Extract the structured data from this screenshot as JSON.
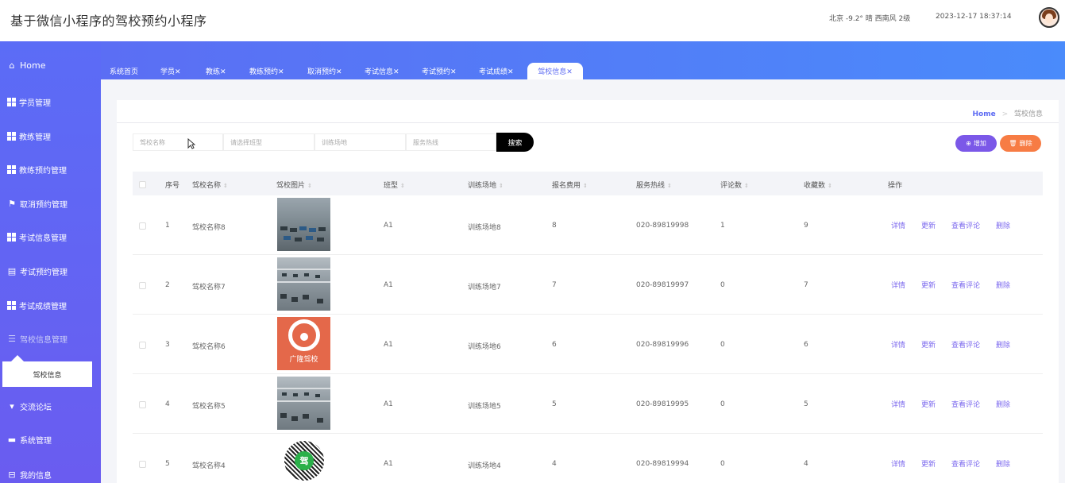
{
  "header": {
    "app_title": "基于微信小程序的驾校预约小程序",
    "weather": "北京  -9.2°  晴  西南风  2级",
    "datetime": "2023-12-17 18:37:14"
  },
  "sidebar": {
    "home": "Home",
    "items": [
      {
        "label": "学员管理"
      },
      {
        "label": "教练管理"
      },
      {
        "label": "教练预约管理"
      },
      {
        "label": "取消预约管理"
      },
      {
        "label": "考试信息管理"
      },
      {
        "label": "考试预约管理"
      },
      {
        "label": "考试成绩管理"
      },
      {
        "label": "驾校信息管理"
      },
      {
        "label": "交流论坛"
      },
      {
        "label": "系统管理"
      },
      {
        "label": "我的信息"
      }
    ],
    "submenu_item": "驾校信息"
  },
  "tabs": [
    {
      "label": "系统首页"
    },
    {
      "label": "学员✕"
    },
    {
      "label": "教练✕"
    },
    {
      "label": "教练预约✕"
    },
    {
      "label": "取消预约✕"
    },
    {
      "label": "考试信息✕"
    },
    {
      "label": "考试预约✕"
    },
    {
      "label": "考试成绩✕"
    },
    {
      "label": "驾校信息✕"
    }
  ],
  "breadcrumb": {
    "home": "Home",
    "sep": ">",
    "current": "驾校信息"
  },
  "filters": {
    "name_placeholder": "驾校名称",
    "type_placeholder": "请选择班型",
    "site_placeholder": "训练场地",
    "phone_placeholder": "服务热线",
    "search_label": "搜索"
  },
  "actions": {
    "add_label": "增加",
    "delete_label": "删除"
  },
  "table": {
    "headers": [
      "序号",
      "驾校名称",
      "驾校图片",
      "班型",
      "训练场地",
      "报名费用",
      "服务热线",
      "评论数",
      "收藏数",
      "操作"
    ],
    "row_actions": [
      "详情",
      "更新",
      "查看评论",
      "删除"
    ],
    "rows": [
      {
        "index": "1",
        "name": "驾校名称8",
        "type": "A1",
        "site": "训练场地8",
        "fee": "8",
        "phone": "020-89819998",
        "comments": "1",
        "favorites": "9",
        "image": "parking-lot-photo"
      },
      {
        "index": "2",
        "name": "驾校名称7",
        "type": "A1",
        "site": "训练场地7",
        "fee": "7",
        "phone": "020-89819997",
        "comments": "0",
        "favorites": "7",
        "image": "parking-lot-photo"
      },
      {
        "index": "3",
        "name": "驾校名称6",
        "type": "A1",
        "site": "训练场地6",
        "fee": "6",
        "phone": "020-89819996",
        "comments": "0",
        "favorites": "6",
        "image": "driving-school-logo",
        "image_text": "广隆驾校"
      },
      {
        "index": "4",
        "name": "驾校名称5",
        "type": "A1",
        "site": "训练场地5",
        "fee": "5",
        "phone": "020-89819995",
        "comments": "0",
        "favorites": "5",
        "image": "parking-lot-photo"
      },
      {
        "index": "5",
        "name": "驾校名称4",
        "type": "A1",
        "site": "训练场地4",
        "fee": "4",
        "phone": "020-89819994",
        "comments": "0",
        "favorites": "4",
        "image": "miniprogram-qr-code",
        "image_text": "驾"
      }
    ]
  },
  "colors": {
    "accent": "#5d6bf3",
    "action_link": "#7b68ee",
    "add": "#7b58e8",
    "delete": "#f77c44"
  }
}
